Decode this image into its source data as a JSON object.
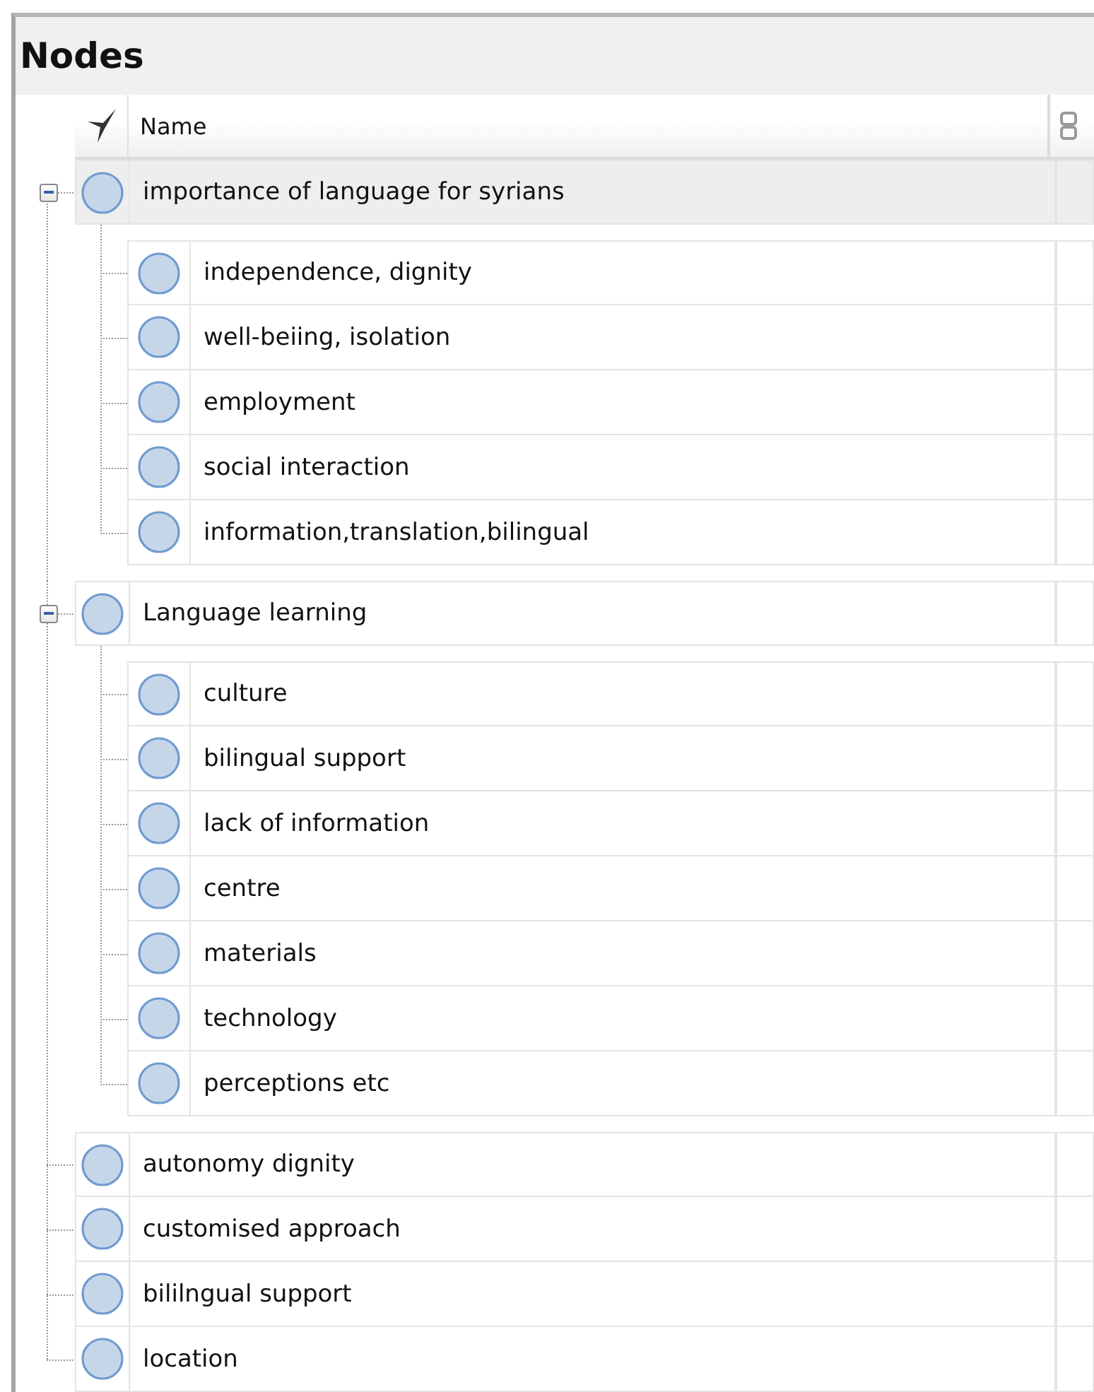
{
  "panel": {
    "title": "Nodes"
  },
  "columns": {
    "name": "Name"
  },
  "nodes": [
    {
      "name": "importance of language for syrians",
      "selected": true,
      "expanded": true,
      "children": [
        {
          "name": "independence, dignity",
          "selected": false
        },
        {
          "name": "well-beiing, isolation",
          "selected": false
        },
        {
          "name": "employment",
          "selected": false
        },
        {
          "name": "social interaction",
          "selected": false
        },
        {
          "name": "information,translation,bilingual",
          "selected": false
        }
      ]
    },
    {
      "name": "Language learning",
      "selected": false,
      "expanded": true,
      "children": [
        {
          "name": "culture",
          "selected": false
        },
        {
          "name": "bilingual support",
          "selected": false
        },
        {
          "name": "lack of information",
          "selected": false
        },
        {
          "name": "centre",
          "selected": false
        },
        {
          "name": "materials",
          "selected": false
        },
        {
          "name": "technology",
          "selected": false
        },
        {
          "name": "perceptions etc",
          "selected": false
        }
      ]
    },
    {
      "name": "autonomy dignity",
      "selected": false
    },
    {
      "name": "customised approach",
      "selected": false
    },
    {
      "name": "bililngual support",
      "selected": false
    },
    {
      "name": "location",
      "selected": false
    }
  ]
}
